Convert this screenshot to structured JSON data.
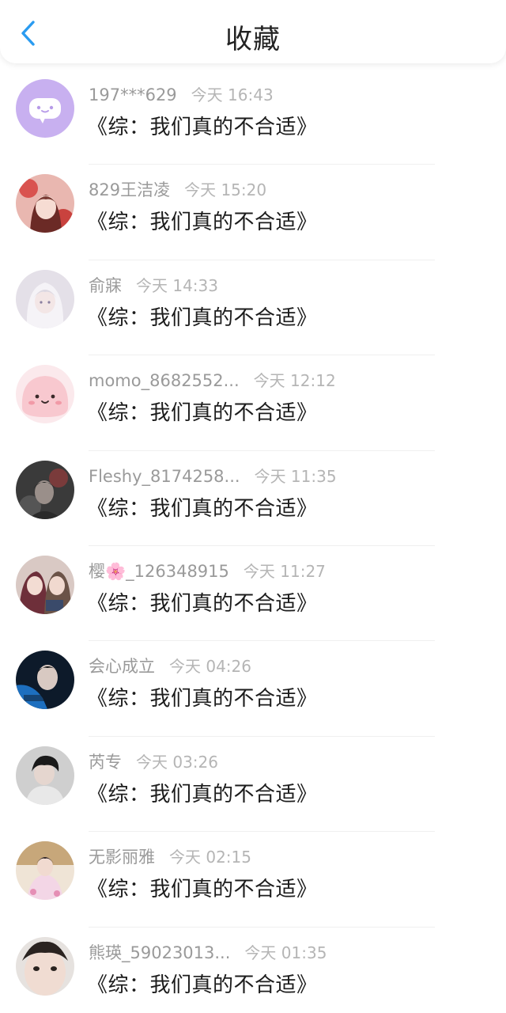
{
  "header": {
    "title": "收藏",
    "accent": "#2a9bf0"
  },
  "favorites": [
    {
      "name": "197***629",
      "time": "今天 16:43",
      "title": "《综：我们真的不合适》",
      "avatar": "chat-bubble-avatar"
    },
    {
      "name": "829王洁凌",
      "time": "今天 15:20",
      "title": "《综：我们真的不合适》",
      "avatar": "anime-girl-red-avatar"
    },
    {
      "name": "俞寐",
      "time": "今天 14:33",
      "title": "《综：我们真的不合适》",
      "avatar": "anime-white-hair-avatar"
    },
    {
      "name": "momo_8682552...",
      "time": "今天 12:12",
      "title": "《综：我们真的不合适》",
      "avatar": "pink-blob-avatar"
    },
    {
      "name": "Fleshy_8174258...",
      "time": "今天 11:35",
      "title": "《综：我们真的不合适》",
      "avatar": "dark-portrait-avatar"
    },
    {
      "name": "樱🌸_126348915",
      "time": "今天 11:27",
      "title": "《综：我们真的不合适》",
      "avatar": "anime-couple-avatar"
    },
    {
      "name": "会心成立",
      "time": "今天 04:26",
      "title": "《综：我们真的不合适》",
      "avatar": "boy-blue-avatar"
    },
    {
      "name": "芮专",
      "time": "今天 03:26",
      "title": "《综：我们真的不合适》",
      "avatar": "boy-grey-avatar"
    },
    {
      "name": "无影丽雅",
      "time": "今天 02:15",
      "title": "《综：我们真的不合适》",
      "avatar": "girl-costume-avatar"
    },
    {
      "name": "熊瑛_59023013...",
      "time": "今天 01:35",
      "title": "《综：我们真的不合适》",
      "avatar": "girl-face-avatar"
    }
  ]
}
